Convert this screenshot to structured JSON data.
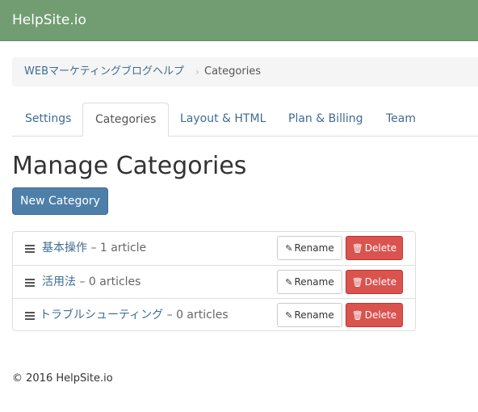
{
  "navbar": {
    "brand": "HelpSite.io"
  },
  "breadcrumb": {
    "parent": "WEBマーケティングブログヘルプ",
    "separator": "›",
    "current": "Categories"
  },
  "tabs": [
    {
      "label": "Settings",
      "active": false
    },
    {
      "label": "Categories",
      "active": true
    },
    {
      "label": "Layout & HTML",
      "active": false
    },
    {
      "label": "Plan & Billing",
      "active": false
    },
    {
      "label": "Team",
      "active": false
    }
  ],
  "page": {
    "title": "Manage Categories",
    "new_button": "New Category"
  },
  "categories": [
    {
      "name": "基本操作",
      "count": "– 1 article"
    },
    {
      "name": "活用法",
      "count": "– 0 articles"
    },
    {
      "name": "トラブルシューティング",
      "count": "– 0 articles"
    }
  ],
  "actions": {
    "rename_label": "Rename",
    "delete_label": "Delete",
    "rename_icon": "pencil-icon",
    "delete_icon": "trash-icon"
  },
  "footer": {
    "text": "© 2016 HelpSite.io"
  },
  "colors": {
    "navbar": "#729d72",
    "link": "#3f6d92",
    "primary": "#4e7fa8",
    "danger": "#d9534f"
  }
}
